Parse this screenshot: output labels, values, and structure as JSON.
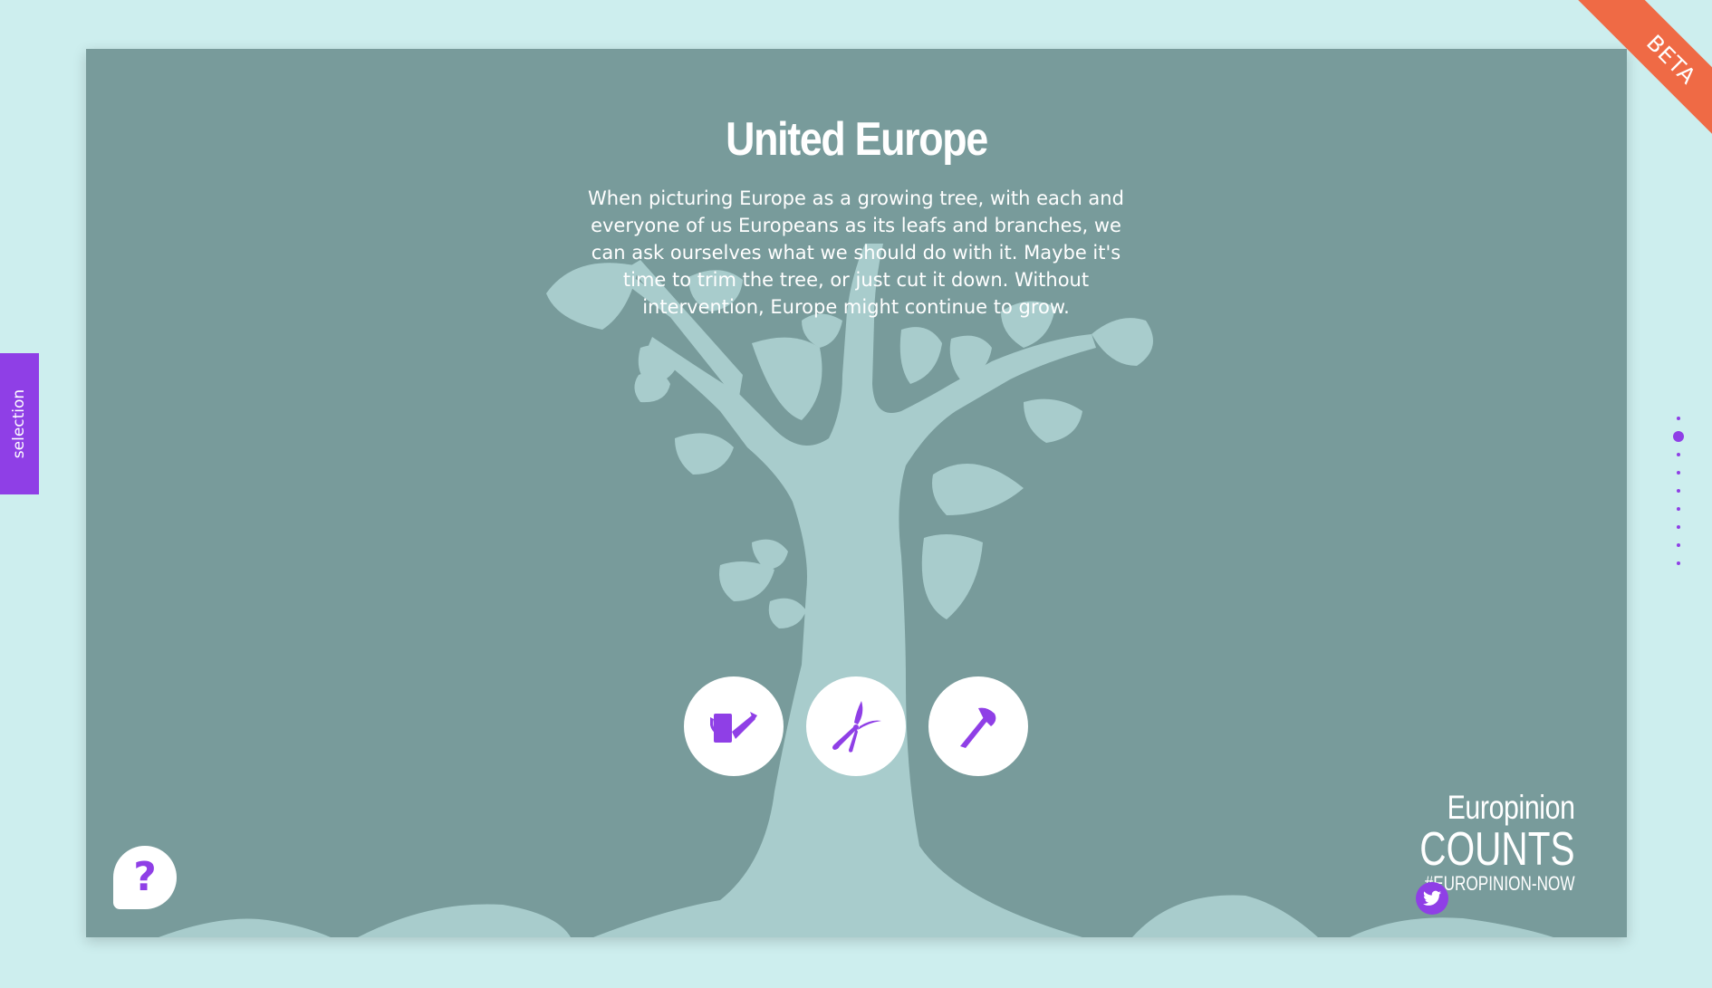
{
  "page": {
    "title": "United Europe",
    "description": "When picturing Europe as a growing tree, with each and everyone of us Europeans as its leafs and branches, we can ask ourselves what we should do with it. Maybe it's time to trim the tree, or just cut it down. Without intervention, Europe might continue to grow."
  },
  "actions": [
    {
      "name": "water",
      "icon": "watering-can-icon"
    },
    {
      "name": "trim",
      "icon": "pruning-shears-icon"
    },
    {
      "name": "cut",
      "icon": "axe-icon"
    }
  ],
  "help": {
    "label": "?",
    "icon": "question-icon"
  },
  "logo": {
    "line1": "Europinion",
    "line2": "COUNTS",
    "line3": "#EUROPINION-NOW"
  },
  "share": {
    "icon": "twitter-icon"
  },
  "sidebar_tab": {
    "label": "selection"
  },
  "beta_ribbon": {
    "label": "BETA"
  },
  "pager": {
    "total": 9,
    "active": 1
  },
  "colors": {
    "background": "#cdeeee",
    "panel": "#789b9b",
    "tree": "#a8cccc",
    "accent": "#8f3fe6",
    "ribbon": "#ef6a45",
    "text": "#ffffff"
  }
}
